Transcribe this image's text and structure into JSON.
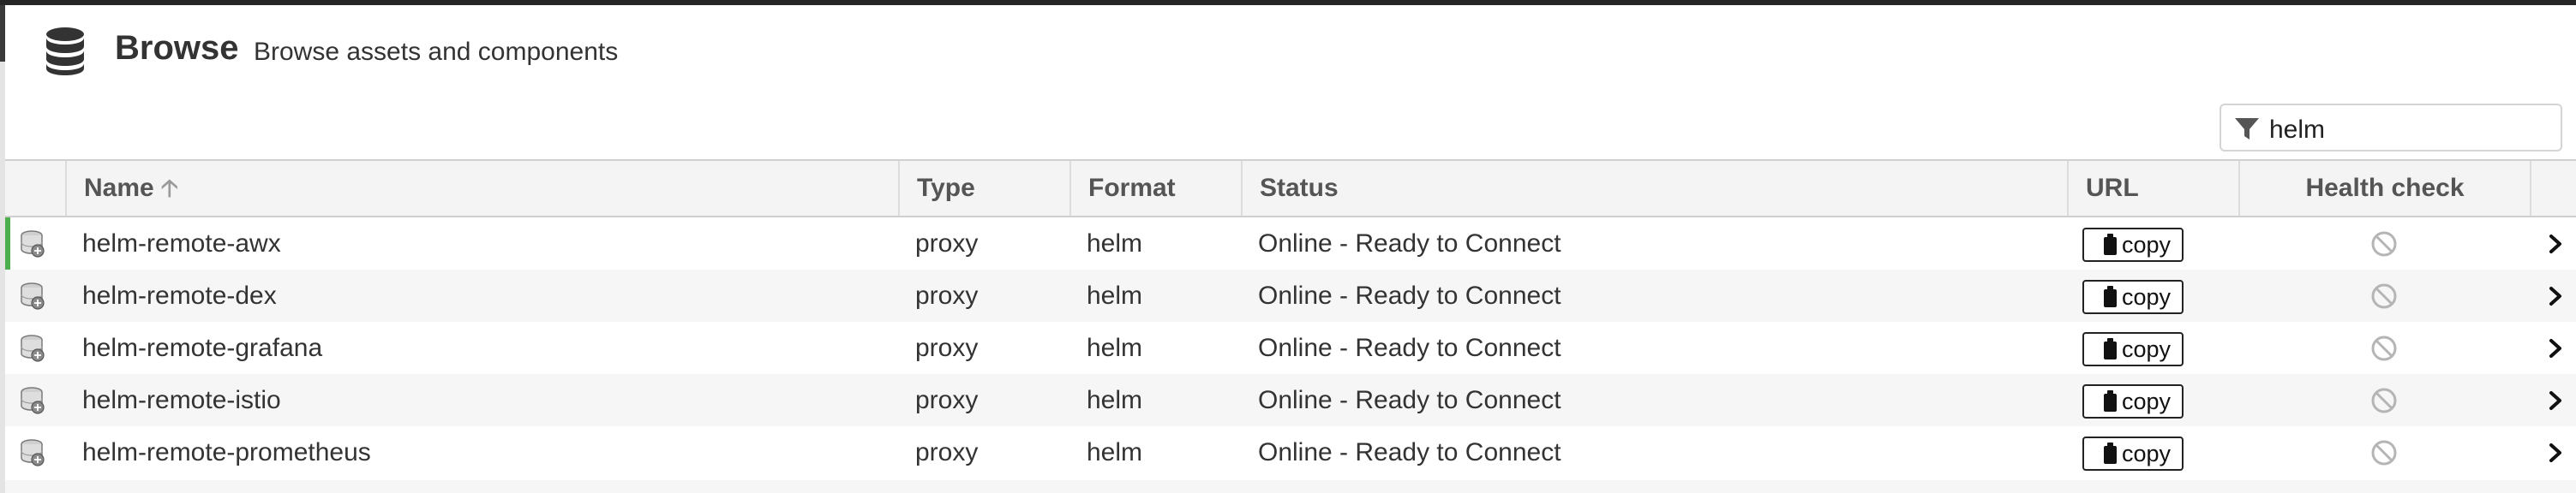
{
  "header": {
    "icon": "database-icon",
    "title": "Browse",
    "subtitle": "Browse assets and components"
  },
  "filter": {
    "icon": "filter-icon",
    "value": "helm"
  },
  "table": {
    "columns": [
      {
        "key": "icon",
        "label": ""
      },
      {
        "key": "name",
        "label": "Name",
        "sort": "ascending"
      },
      {
        "key": "type",
        "label": "Type"
      },
      {
        "key": "format",
        "label": "Format"
      },
      {
        "key": "status",
        "label": "Status"
      },
      {
        "key": "url",
        "label": "URL"
      },
      {
        "key": "health",
        "label": "Health check"
      },
      {
        "key": "open",
        "label": ""
      }
    ],
    "copy_label": "copy",
    "rows": [
      {
        "name": "helm-remote-awx",
        "type": "proxy",
        "format": "helm",
        "status": "Online - Ready to Connect"
      },
      {
        "name": "helm-remote-dex",
        "type": "proxy",
        "format": "helm",
        "status": "Online - Ready to Connect"
      },
      {
        "name": "helm-remote-grafana",
        "type": "proxy",
        "format": "helm",
        "status": "Online - Ready to Connect"
      },
      {
        "name": "helm-remote-istio",
        "type": "proxy",
        "format": "helm",
        "status": "Online - Ready to Connect"
      },
      {
        "name": "helm-remote-prometheus",
        "type": "proxy",
        "format": "helm",
        "status": "Online - Ready to Connect"
      }
    ],
    "selected_row": 0
  },
  "colors": {
    "selected_indicator": "#4cae4c",
    "header_bg": "#f4f4f4",
    "alt_row_bg": "#f6f6f6"
  }
}
